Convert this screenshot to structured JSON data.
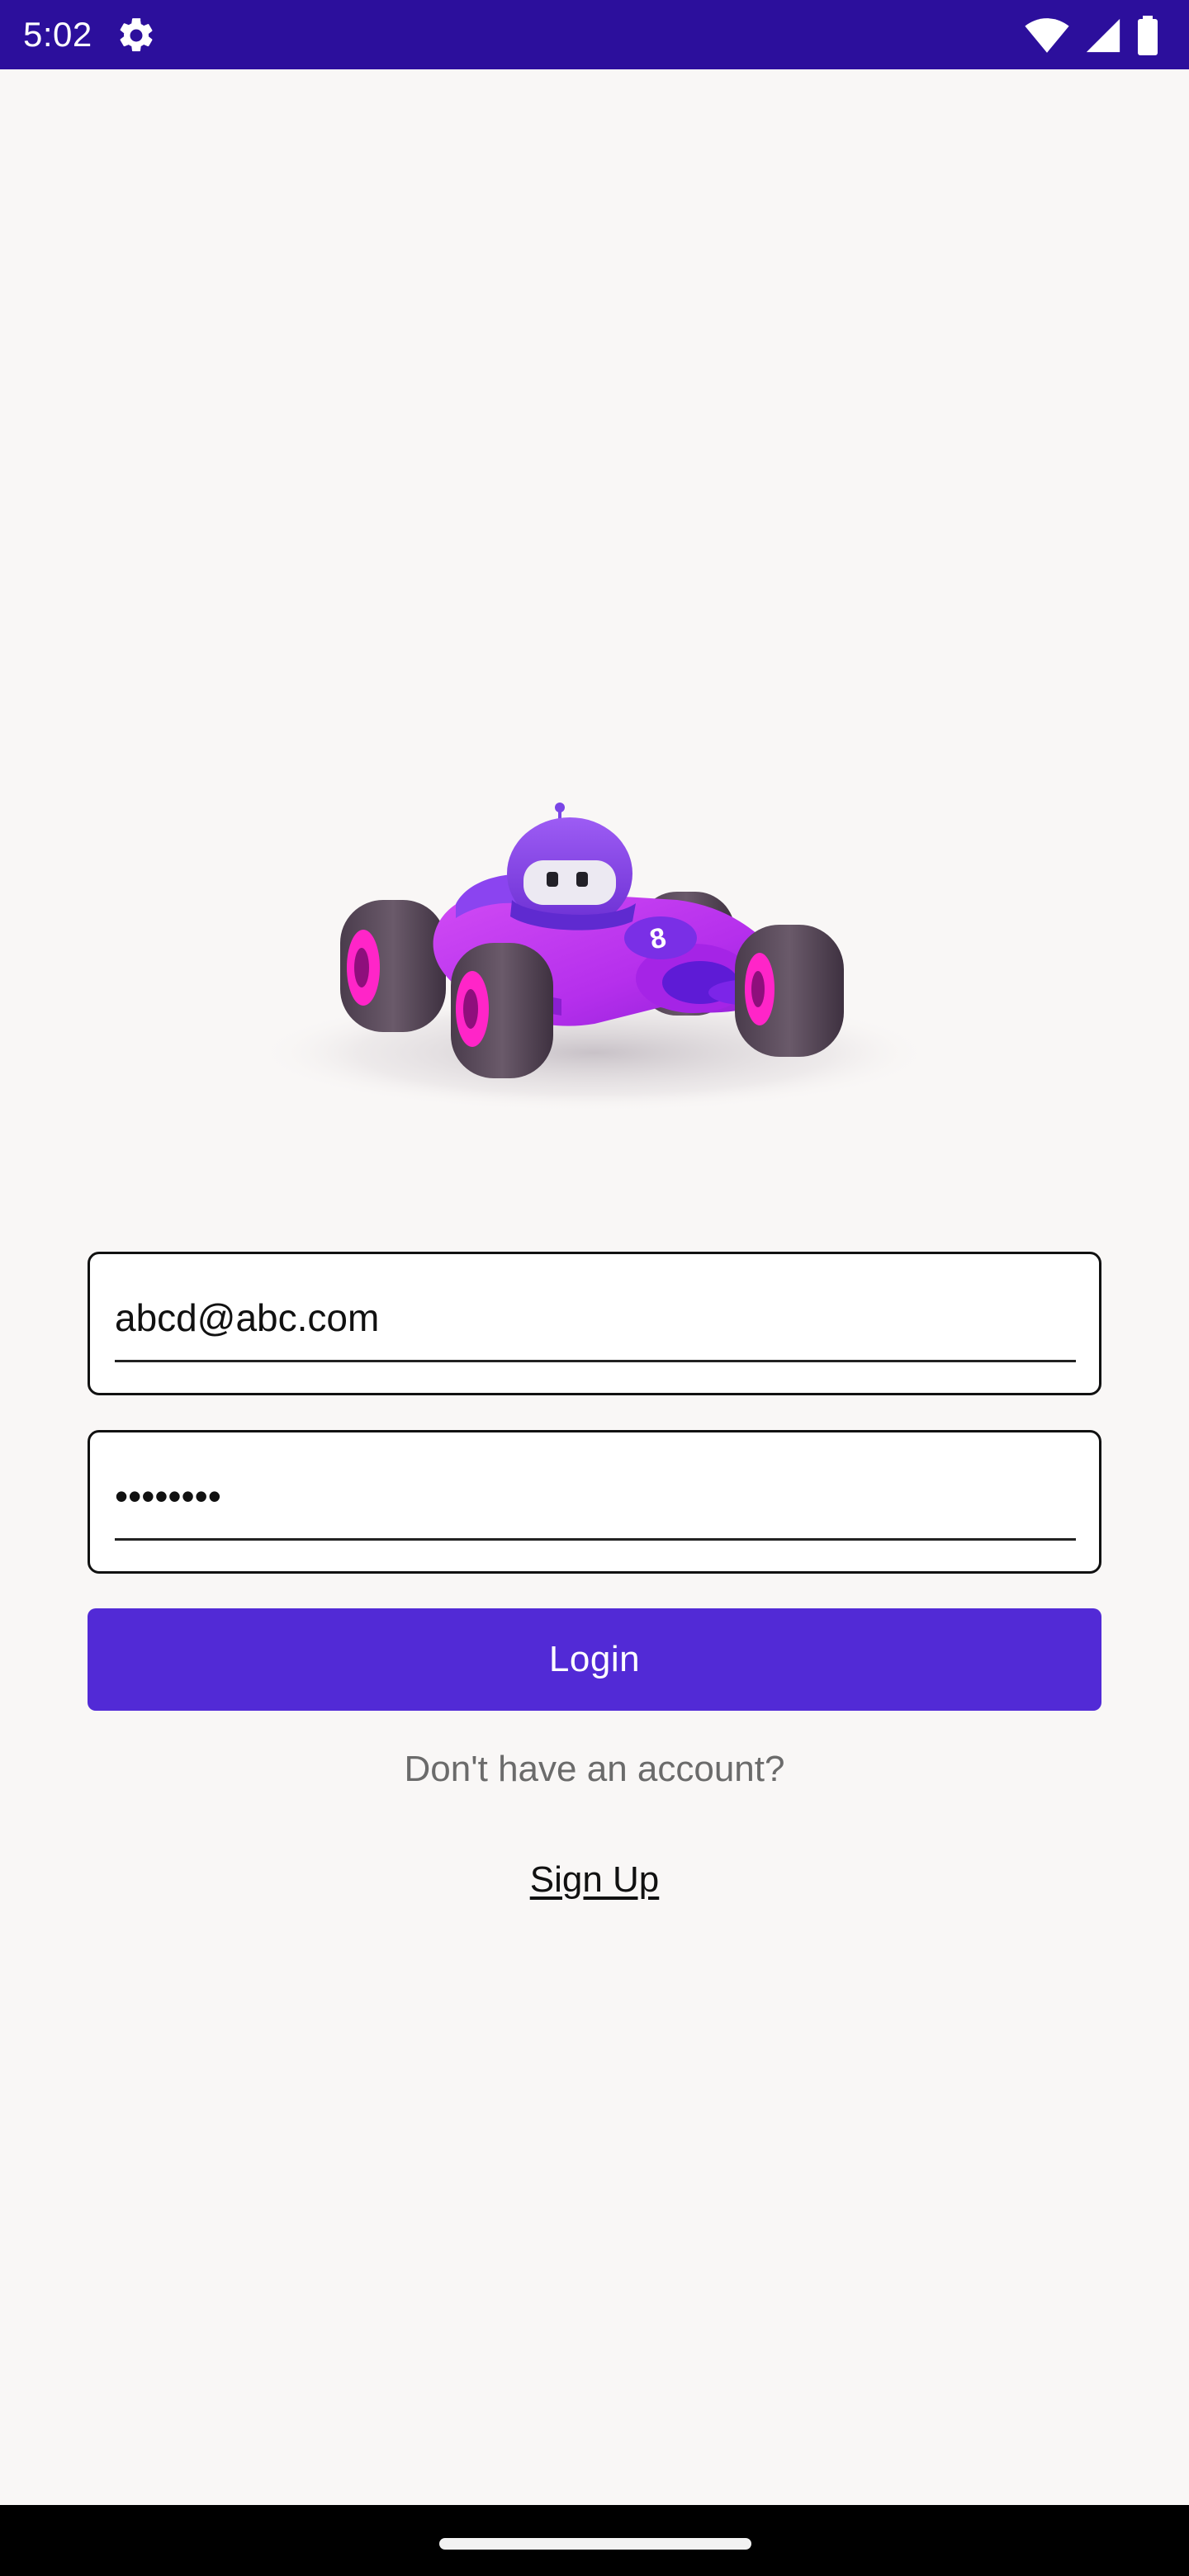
{
  "status_bar": {
    "time": "5:02",
    "icons": [
      "settings-gear-icon",
      "wifi-icon",
      "cellular-signal-icon",
      "battery-icon"
    ]
  },
  "hero_image": {
    "icon": "race-car-illustration",
    "car_number": "8"
  },
  "login_form": {
    "email_value": "abcd@abc.com",
    "password_value": "••••••••",
    "login_label": "Login",
    "no_account_text": "Don't have an account?",
    "signup_label": "Sign Up"
  },
  "colors": {
    "status_bar": "#2c0f9c",
    "background": "#f9f7f6",
    "accent": "#522ad6",
    "car_body": "#c533f2",
    "tire": "#5e4e5e",
    "rim": "#ff25c8"
  }
}
